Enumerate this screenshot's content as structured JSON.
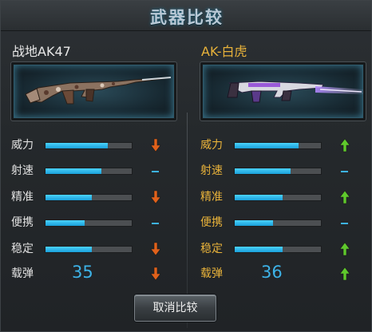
{
  "title": "武器比较",
  "left": {
    "name": "战地AK47",
    "weapon_image": "ak47-camo-bayonet",
    "stats": [
      {
        "label": "威力",
        "fill": 0.72,
        "trend": "down"
      },
      {
        "label": "射速",
        "fill": 0.65,
        "trend": "neutral"
      },
      {
        "label": "精准",
        "fill": 0.54,
        "trend": "down"
      },
      {
        "label": "便携",
        "fill": 0.45,
        "trend": "neutral"
      },
      {
        "label": "稳定",
        "fill": 0.54,
        "trend": "down"
      }
    ],
    "ammo": {
      "label": "载弹",
      "value": "35",
      "trend": "down"
    }
  },
  "right": {
    "name": "AK-白虎",
    "weapon_image": "ak-white-tiger-purple-blade",
    "stats": [
      {
        "label": "威力",
        "fill": 0.74,
        "trend": "up"
      },
      {
        "label": "射速",
        "fill": 0.65,
        "trend": "neutral"
      },
      {
        "label": "精准",
        "fill": 0.56,
        "trend": "up"
      },
      {
        "label": "便携",
        "fill": 0.44,
        "trend": "neutral"
      },
      {
        "label": "稳定",
        "fill": 0.56,
        "trend": "up"
      }
    ],
    "ammo": {
      "label": "载弹",
      "value": "36",
      "trend": "up"
    }
  },
  "colors": {
    "up": "#5fc92c",
    "down": "#e0611b",
    "neutral": "#3db3e8",
    "bar_fill": "#1a9fd8",
    "right_name": "#e8b23a"
  },
  "icons": {
    "up": "arrow-up-icon",
    "down": "arrow-down-icon",
    "neutral": "dash-icon"
  },
  "buttons": {
    "cancel": "取消比较"
  }
}
